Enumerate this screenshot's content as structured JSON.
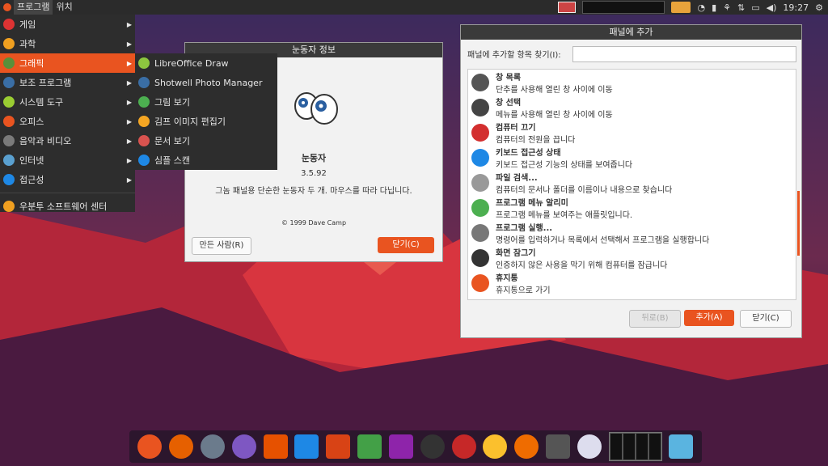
{
  "top_panel": {
    "programs": "프로그램",
    "places": "위치",
    "clock": "19:27"
  },
  "menu": {
    "items": [
      {
        "label": "게임",
        "color": "#d33"
      },
      {
        "label": "과학",
        "color": "#f0a020"
      },
      {
        "label": "그래픽",
        "color": "#5a8f3a"
      },
      {
        "label": "보조 프로그램",
        "color": "#3a6ea5"
      },
      {
        "label": "시스템 도구",
        "color": "#9acd32"
      },
      {
        "label": "오피스",
        "color": "#e95420"
      },
      {
        "label": "음악과 비디오",
        "color": "#7a7a7a"
      },
      {
        "label": "인터넷",
        "color": "#5aa0d0"
      },
      {
        "label": "접근성",
        "color": "#1e88e5"
      }
    ],
    "software_center": "우분투 소프트웨어 센터"
  },
  "submenu": {
    "items": [
      {
        "label": "LibreOffice Draw",
        "color": "#8dc63f"
      },
      {
        "label": "Shotwell Photo Manager",
        "color": "#3a6ea5"
      },
      {
        "label": "그림 보기",
        "color": "#4caf50"
      },
      {
        "label": "김프 이미지 편집기",
        "color": "#f5a623"
      },
      {
        "label": "문서 보기",
        "color": "#d9534f"
      },
      {
        "label": "심플 스캔",
        "color": "#1e88e5"
      }
    ]
  },
  "about": {
    "title": "눈동자 정보",
    "name": "눈동자",
    "version": "3.5.92",
    "description": "그놈 패널용 단순한 눈동자 두 개. 마우스를 따라 다닙니다.",
    "copyright": "© 1999 Dave Camp",
    "credits": "만든 사람(R)",
    "close": "닫기(C)"
  },
  "add_to_panel": {
    "title": "패널에 추가",
    "find_label": "패널에 추가할 항목 찾기(I):",
    "items": [
      {
        "title": "창 목록",
        "desc": "단추를 사용해 열린 창 사이에 이동",
        "color": "#555"
      },
      {
        "title": "창 선택",
        "desc": "메뉴를 사용해 열린 창 사이에 이동",
        "color": "#444"
      },
      {
        "title": "컴퓨터 끄기",
        "desc": "컴퓨터의 전원을 끕니다",
        "color": "#d32f2f"
      },
      {
        "title": "키보드 접근성 상태",
        "desc": "키보드 접근성 기능의 상태를 보여줍니다",
        "color": "#1e88e5"
      },
      {
        "title": "파일 검색...",
        "desc": "컴퓨터의 문서나 폴더를 이름이나 내용으로 찾습니다",
        "color": "#999"
      },
      {
        "title": "프로그램 메뉴 알리미",
        "desc": "프로그램 메뉴를 보여주는 애플릿입니다.",
        "color": "#4caf50"
      },
      {
        "title": "프로그램 실행...",
        "desc": "명령어를 입력하거나 목록에서 선택해서 프로그램을 실행합니다",
        "color": "#777"
      },
      {
        "title": "화면 잠그기",
        "desc": "인증하지 않은 사용을 막기 위해 컴퓨터를 잠급니다",
        "color": "#333"
      },
      {
        "title": "휴지통",
        "desc": "휴지통으로 가기",
        "color": "#e95420"
      }
    ],
    "back": "뒤로(B)",
    "add": "추가(A)",
    "close": "닫기(C)"
  },
  "dock": {
    "icons": [
      {
        "name": "anchor-icon",
        "color": "#e95420"
      },
      {
        "name": "firefox-icon",
        "color": "#e66000"
      },
      {
        "name": "files-icon",
        "color": "#6b7b8c"
      },
      {
        "name": "media-player-icon",
        "color": "#7e57c2"
      },
      {
        "name": "speaker-icon",
        "color": "#e65100"
      },
      {
        "name": "writer-icon",
        "color": "#1e88e5"
      },
      {
        "name": "impress-icon",
        "color": "#d84315"
      },
      {
        "name": "calc-icon",
        "color": "#43a047"
      },
      {
        "name": "notes-icon",
        "color": "#8e24aa"
      },
      {
        "name": "terminal-icon",
        "color": "#333"
      },
      {
        "name": "switch-icon",
        "color": "#c62828"
      },
      {
        "name": "archive-icon",
        "color": "#fbc02d"
      },
      {
        "name": "screenshot-icon",
        "color": "#ef6c00"
      },
      {
        "name": "window-icon",
        "color": "#555"
      },
      {
        "name": "eyes-icon",
        "color": "#dde"
      }
    ]
  }
}
